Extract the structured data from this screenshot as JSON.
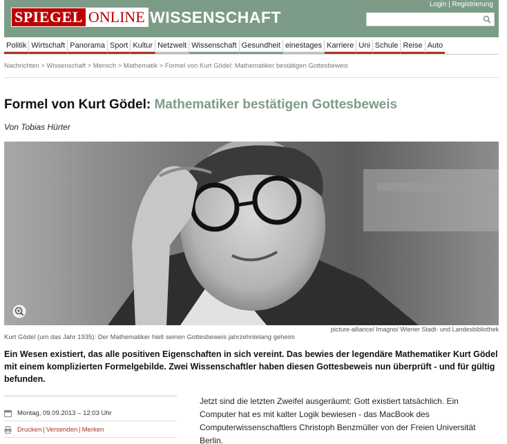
{
  "header": {
    "logo_spiegel": "SPIEGEL",
    "logo_online": "ONLINE",
    "section": "WISSENSCHAFT",
    "login": "Login",
    "register": "Registrierung",
    "search_placeholder": ""
  },
  "nav": {
    "items": [
      {
        "label": "Politik"
      },
      {
        "label": "Wirtschaft"
      },
      {
        "label": "Panorama"
      },
      {
        "label": "Sport"
      },
      {
        "label": "Kultur"
      },
      {
        "label": "Netzwelt"
      },
      {
        "label": "Wissenschaft"
      },
      {
        "label": "Gesundheit"
      },
      {
        "label": "einestages"
      },
      {
        "label": "Karriere"
      },
      {
        "label": "Uni"
      },
      {
        "label": "Schule"
      },
      {
        "label": "Reise"
      },
      {
        "label": "Auto"
      }
    ]
  },
  "breadcrumb": "Nachrichten > Wissenschaft > Mensch > Mathematik > Formel von Kurt Gödel: Mathematiker bestätigen Gottesbeweis",
  "article": {
    "kicker": "Formel von Kurt Gödel:",
    "title": "Mathematiker bestätigen Gottesbeweis",
    "author": "Von Tobias Hürter",
    "photo_credit": "picture-alliance/ Imagno/ Wiener Stadt- und Landesbibliothek",
    "caption": "Kurt Gödel (um das Jahr 1935): Der Mathematiker hielt seinen Gottesbeweis jahrzehntelang geheim",
    "lead": "Ein Wesen existiert, das alle positiven Eigenschaften in sich vereint. Das bewies der legendäre Mathematiker Kurt Gödel mit einem komplizierten Formelgebilde. Zwei Wissenschaftler haben diesen Gottesbeweis nun überprüft - und für gültig befunden.",
    "date": "Montag, 09.09.2013 – 12:03 Uhr",
    "actions": {
      "print": "Drucken",
      "send": "Versenden",
      "remember": "Merken"
    },
    "body": "Jetzt sind die letzten Zweifel ausgeräumt: Gott existiert tatsächlich. Ein Computer hat es mit kalter Logik bewiesen - das MacBook des Computerwissenschaftlers Christoph Benzmüller von der Freien Universität Berlin."
  },
  "colors": {
    "brand_green": "#7d9c87",
    "brand_red": "#bb0000",
    "link_red": "#aa3322"
  }
}
